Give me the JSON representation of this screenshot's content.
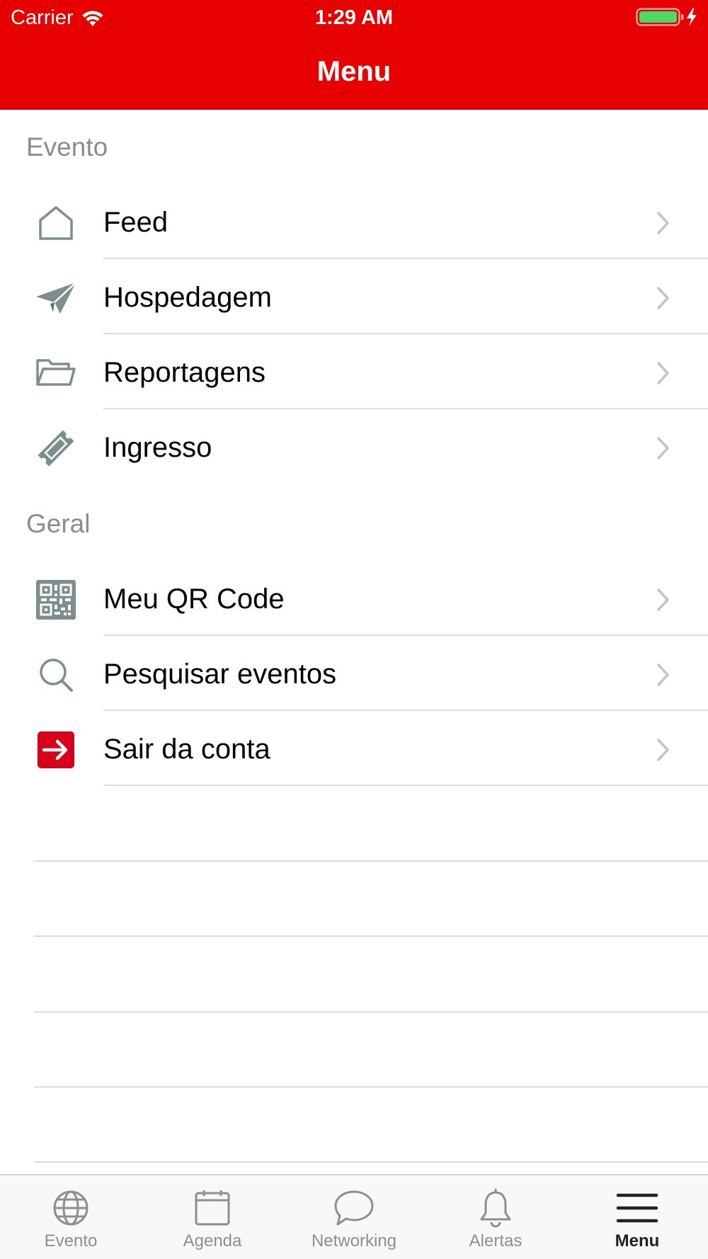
{
  "status_bar": {
    "carrier": "Carrier",
    "time": "1:29 AM",
    "battery_color": "#4cd964"
  },
  "header": {
    "title": "Menu",
    "background": "#e60000"
  },
  "sections": [
    {
      "title": "Evento",
      "items": [
        {
          "label": "Feed",
          "icon": "home-icon"
        },
        {
          "label": "Hospedagem",
          "icon": "paper-plane-icon"
        },
        {
          "label": "Reportagens",
          "icon": "folder-open-icon"
        },
        {
          "label": "Ingresso",
          "icon": "ticket-icon"
        }
      ]
    },
    {
      "title": "Geral",
      "items": [
        {
          "label": "Meu QR Code",
          "icon": "qr-code-icon"
        },
        {
          "label": "Pesquisar eventos",
          "icon": "search-icon"
        },
        {
          "label": "Sair da conta",
          "icon": "logout-icon"
        }
      ]
    }
  ],
  "colors": {
    "accent": "#e60000",
    "icon_gray": "#7d8e8e",
    "logout_red": "#d9001b",
    "section_header": "#8c8c8c",
    "divider": "#dcdcdc",
    "tab_inactive": "#8e8e8e",
    "tab_active": "#222222"
  },
  "tabbar": {
    "tabs": [
      {
        "label": "Evento",
        "icon": "globe-icon",
        "active": false
      },
      {
        "label": "Agenda",
        "icon": "calendar-icon",
        "active": false
      },
      {
        "label": "Networking",
        "icon": "chat-bubble-icon",
        "active": false
      },
      {
        "label": "Alertas",
        "icon": "bell-icon",
        "active": false
      },
      {
        "label": "Menu",
        "icon": "hamburger-menu-icon",
        "active": true
      }
    ]
  }
}
